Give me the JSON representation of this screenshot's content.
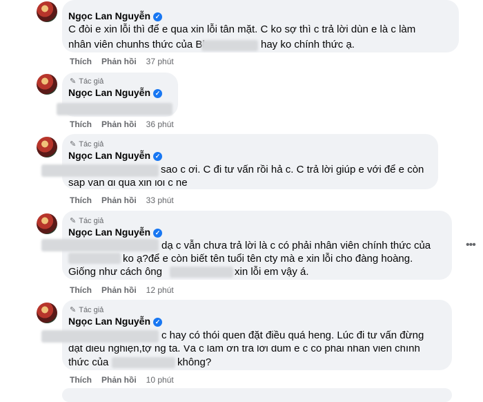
{
  "author_tag": "Tác giả",
  "author_name": "Ngọc Lan Nguyễn",
  "like_label": "Thích",
  "reply_label": "Phản hồi",
  "more_icon": "more-horizontal-icon",
  "comments": [
    {
      "line1": "C đòi e xin lỗi thì để e qua xin lỗi tân mặt. C ko sợ thì c trả lời dùn e là c làm",
      "line2a": "nhân viên chunhs thức của Bh",
      "line2b": "hay ko chính thức ạ.",
      "time": "37 phút"
    },
    {
      "time": "36 phút"
    },
    {
      "line1": "sao c ơi. C đi tư vấn rồi hả c. C trả lời giúp e với để e còn",
      "line2": "sắp vấn đi qua xin lỗi c nè",
      "time": "33 phút"
    },
    {
      "line1": "dạ c vẫn chưa trả lời là c có phải nhân viên chính thức của",
      "line2": "ko ạ?để e còn biết tên tuổi tên cty mà e xin lỗi cho đàng hoàng.",
      "line3a": "Giống như cách ông",
      "line3b": "xin lỗi em vậy á.",
      "time": "12 phút"
    },
    {
      "line1": "c hay có thói quen đặt điều quá heng. Lúc đi tư vấn đừng",
      "line2": "đặt điều nghiện,tợ ng ta. Và c làm ơn trả lời dùm e c có phải nhân viên chính",
      "line3a": "thức của",
      "line3b": "không?",
      "time": "10 phút"
    }
  ]
}
